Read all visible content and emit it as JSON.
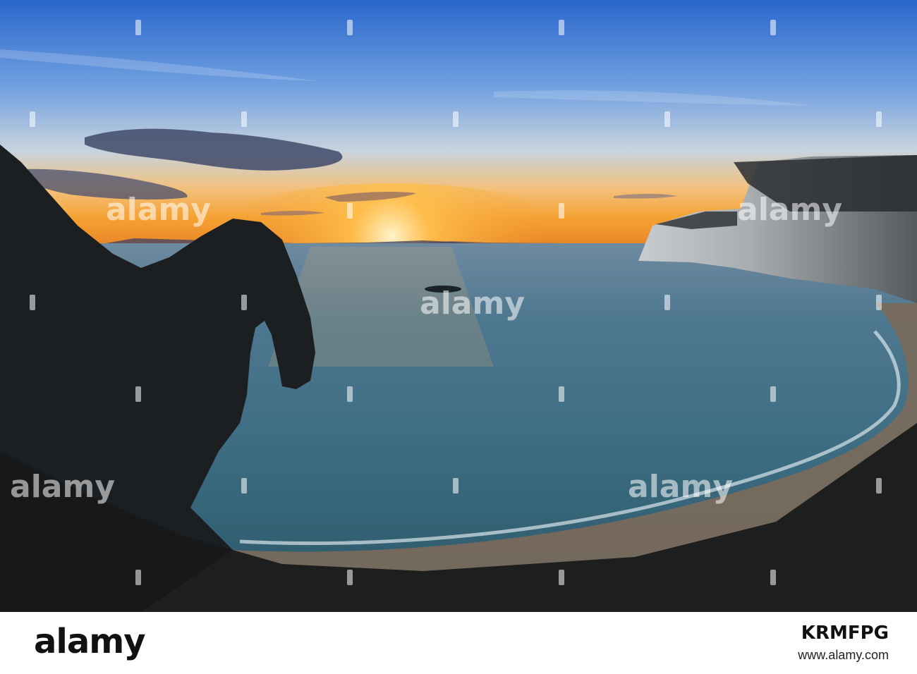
{
  "photo": {
    "description_colors": {
      "sky_top": "#2f6fd0",
      "sky_mid": "#7ea7df",
      "horizon_glow": "#f4a233",
      "sea": "#3c6f86",
      "cliff": "#1c1f22"
    }
  },
  "watermark": {
    "text": "alamy"
  },
  "footer": {
    "logo": "alamy",
    "image_id": "KRMFPG",
    "url": "www.alamy.com"
  }
}
